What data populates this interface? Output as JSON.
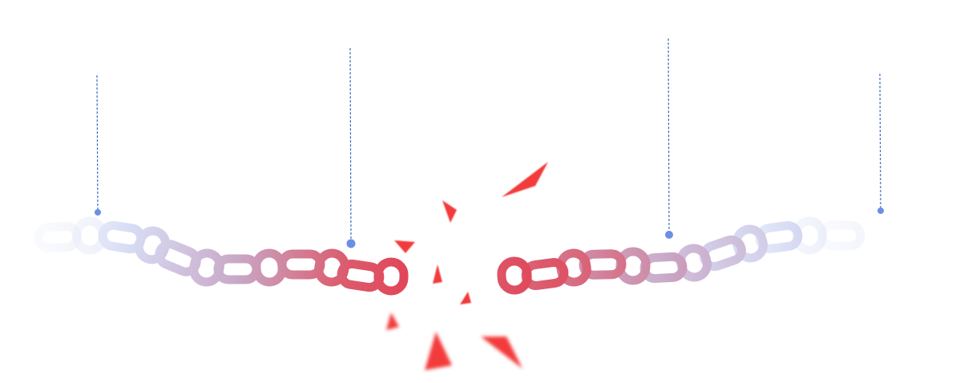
{
  "illustration": {
    "kind": "broken-chain",
    "link_colors": {
      "outer": "#e3e8fa",
      "middle": "#cbb4d0",
      "inner": "#df5868"
    },
    "pin_color": "#6b8fe6",
    "line_color": "#3d6fbf",
    "fragment_color": "#f33a3a",
    "pin_count": 4,
    "fragment_count": 8,
    "background": "#ffffff"
  }
}
